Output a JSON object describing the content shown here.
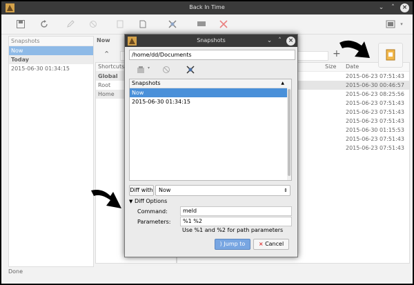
{
  "window": {
    "title": "Back In Time"
  },
  "left_panel": {
    "header": "Snapshots",
    "now": "Now",
    "group": "Today",
    "item": "2015-06-30 01:34:15"
  },
  "main": {
    "now_label": "Now",
    "shortcuts_header": "Shortcuts",
    "shortcuts": [
      "Global",
      "Root",
      "Home"
    ],
    "columns": {
      "size": "Size",
      "date": "Date"
    },
    "dates": [
      "2015-06-23 07:51:43",
      "2015-06-30 00:46:57",
      "2015-06-23 08:25:56",
      "2015-06-23 07:51:43",
      "2015-06-23 07:51:43",
      "2015-06-23 07:51:43",
      "2015-06-30 01:15:53",
      "2015-06-23 07:51:43",
      "2015-06-23 07:51:43"
    ]
  },
  "status": "Done",
  "dialog": {
    "title": "Snapshots",
    "path": "/home/dd/Documents",
    "list_header": "Snapshots",
    "list_items": [
      "Now",
      "2015-06-30 01:34:15"
    ],
    "diff_with_label": "Diff with",
    "diff_select_value": "Now",
    "diff_options_label": "Diff Options",
    "command_label": "Command:",
    "command_value": "meld",
    "parameters_label": "Parameters:",
    "parameters_value": "%1 %2",
    "hint": "Use %1 and %2 for path parameters",
    "jump_label": "Jump to",
    "cancel_label": "Cancel"
  },
  "colors": {
    "accent": "#4a90d9",
    "titlebar": "#3a3a3a"
  }
}
